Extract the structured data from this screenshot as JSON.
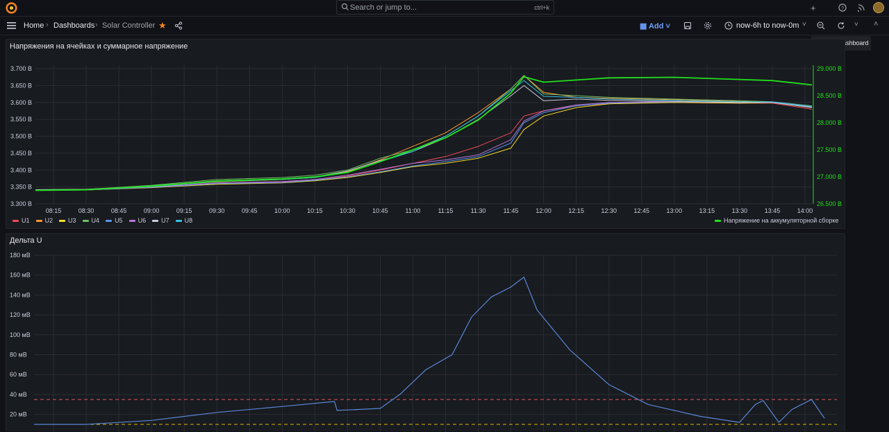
{
  "topbar": {
    "search_placeholder": "Search or jump to...",
    "search_shortcut": "ctrl+k",
    "plus_label": "+",
    "icons": [
      "grafana-logo-icon",
      "search-icon",
      "plus-icon",
      "help-icon",
      "rss-icon",
      "user-avatar"
    ]
  },
  "nav": {
    "home": "Home",
    "dashboards": "Dashboards",
    "current": "Solar Controller",
    "add_label": "Add",
    "time_range": "now-6h to now-0m",
    "tooltip": "Refresh dashboard"
  },
  "colors": {
    "U1": "#f2495c",
    "U2": "#ff9830",
    "U3": "#fade2a",
    "U4": "#73bf69",
    "U5": "#5794f2",
    "U6": "#b877d9",
    "U7": "#ccccdc",
    "U8": "#37c2e6",
    "battery": "#22e01d",
    "delta": "#5a87d8",
    "threshold_red": "#e0575f",
    "threshold_yellow": "#e0b400"
  },
  "panel1": {
    "title": "Напряжения на ячейках и суммарное напряжение",
    "legend_left": [
      "U1",
      "U2",
      "U3",
      "U4",
      "U5",
      "U6",
      "U7",
      "U8"
    ],
    "legend_right": "Напряжение на аккумуляторной сборке"
  },
  "panel2": {
    "title": "Дельта U"
  },
  "chart_data": [
    {
      "type": "line",
      "title": "Напряжения на ячейках и суммарное напряжение",
      "x": [
        "08:15",
        "08:30",
        "08:45",
        "09:00",
        "09:15",
        "09:30",
        "09:45",
        "10:00",
        "10:15",
        "10:30",
        "10:45",
        "11:00",
        "11:15",
        "11:30",
        "11:45",
        "12:00",
        "12:15",
        "12:30",
        "12:45",
        "13:00",
        "13:15",
        "13:30",
        "13:45",
        "14:00"
      ],
      "y_left_ticks": [
        "3.300 В",
        "3.350 В",
        "3.400 В",
        "3.450 В",
        "3.500 В",
        "3.550 В",
        "3.600 В",
        "3.650 В",
        "3.700 В"
      ],
      "y_right_ticks": [
        "26.500 В",
        "27.000 В",
        "27.500 В",
        "28.000 В",
        "28.500 В",
        "29.000 В"
      ],
      "ylim_left": [
        3.3,
        3.7
      ],
      "ylim_right": [
        26.5,
        29.0
      ],
      "grid": true,
      "series_points_time_hours": [
        8.0,
        8.5,
        9.0,
        9.5,
        10.0,
        10.25,
        10.5,
        10.75,
        11.0,
        11.25,
        11.5,
        11.75,
        11.85,
        12.0,
        12.25,
        12.5,
        13.0,
        13.5,
        13.75,
        14.1
      ],
      "series": [
        {
          "name": "U1",
          "axis": "left",
          "values": [
            3.341,
            3.342,
            3.35,
            3.36,
            3.365,
            3.37,
            3.382,
            3.4,
            3.42,
            3.44,
            3.47,
            3.51,
            3.56,
            3.575,
            3.59,
            3.597,
            3.6,
            3.598,
            3.598,
            3.58
          ]
        },
        {
          "name": "U2",
          "axis": "left",
          "values": [
            3.341,
            3.342,
            3.352,
            3.365,
            3.372,
            3.378,
            3.395,
            3.43,
            3.47,
            3.51,
            3.57,
            3.64,
            3.68,
            3.63,
            3.615,
            3.612,
            3.608,
            3.603,
            3.6,
            3.585
          ]
        },
        {
          "name": "U3",
          "axis": "left",
          "values": [
            3.34,
            3.341,
            3.348,
            3.358,
            3.362,
            3.368,
            3.378,
            3.393,
            3.41,
            3.42,
            3.435,
            3.465,
            3.52,
            3.56,
            3.585,
            3.596,
            3.6,
            3.598,
            3.6,
            3.585
          ]
        },
        {
          "name": "U4",
          "axis": "left",
          "values": [
            3.342,
            3.343,
            3.355,
            3.372,
            3.378,
            3.385,
            3.4,
            3.435,
            3.46,
            3.5,
            3.56,
            3.64,
            3.68,
            3.625,
            3.62,
            3.615,
            3.61,
            3.605,
            3.602,
            3.59
          ]
        },
        {
          "name": "U5",
          "axis": "left",
          "values": [
            3.34,
            3.341,
            3.349,
            3.36,
            3.363,
            3.37,
            3.38,
            3.395,
            3.412,
            3.425,
            3.44,
            3.48,
            3.54,
            3.57,
            3.59,
            3.598,
            3.602,
            3.6,
            3.602,
            3.588
          ]
        },
        {
          "name": "U6",
          "axis": "left",
          "values": [
            3.341,
            3.342,
            3.35,
            3.362,
            3.366,
            3.372,
            3.385,
            3.402,
            3.42,
            3.43,
            3.445,
            3.49,
            3.545,
            3.575,
            3.593,
            3.6,
            3.603,
            3.6,
            3.601,
            3.586
          ]
        },
        {
          "name": "U7",
          "axis": "left",
          "values": [
            3.342,
            3.343,
            3.353,
            3.368,
            3.374,
            3.38,
            3.397,
            3.428,
            3.455,
            3.495,
            3.55,
            3.62,
            3.65,
            3.605,
            3.61,
            3.606,
            3.603,
            3.6,
            3.6,
            3.585
          ]
        },
        {
          "name": "U8",
          "axis": "left",
          "values": [
            3.341,
            3.342,
            3.351,
            3.366,
            3.372,
            3.378,
            3.393,
            3.425,
            3.455,
            3.5,
            3.56,
            3.635,
            3.665,
            3.618,
            3.615,
            3.61,
            3.606,
            3.602,
            3.601,
            3.588
          ]
        },
        {
          "name": "Напряжение на аккумуляторной сборке",
          "axis": "right",
          "values": [
            26.75,
            26.76,
            26.83,
            26.92,
            26.96,
            27.0,
            27.08,
            27.28,
            27.5,
            27.72,
            28.05,
            28.55,
            28.85,
            28.75,
            28.79,
            28.83,
            28.84,
            28.8,
            28.78,
            28.7
          ]
        }
      ]
    },
    {
      "type": "line",
      "title": "Дельта U",
      "y_ticks": [
        "20 мВ",
        "40 мВ",
        "60 мВ",
        "80 мВ",
        "100 мВ",
        "120 мВ",
        "140 мВ",
        "160 мВ",
        "180 мВ"
      ],
      "ylim": [
        10,
        180
      ],
      "grid": true,
      "thresholds": [
        35,
        10
      ],
      "series_points_time_hours": [
        8.0,
        8.5,
        9.0,
        9.5,
        10.0,
        10.4,
        10.42,
        10.75,
        10.9,
        11.1,
        11.3,
        11.45,
        11.6,
        11.75,
        11.85,
        11.95,
        12.2,
        12.5,
        12.8,
        13.2,
        13.5,
        13.62,
        13.68,
        13.8,
        13.9,
        14.05,
        14.15
      ],
      "series": [
        {
          "name": "",
          "values": [
            10,
            10,
            14,
            22,
            28,
            33,
            24,
            26,
            40,
            65,
            80,
            118,
            138,
            148,
            158,
            125,
            85,
            50,
            30,
            18,
            12,
            30,
            34,
            12,
            25,
            35,
            16
          ]
        }
      ]
    }
  ]
}
